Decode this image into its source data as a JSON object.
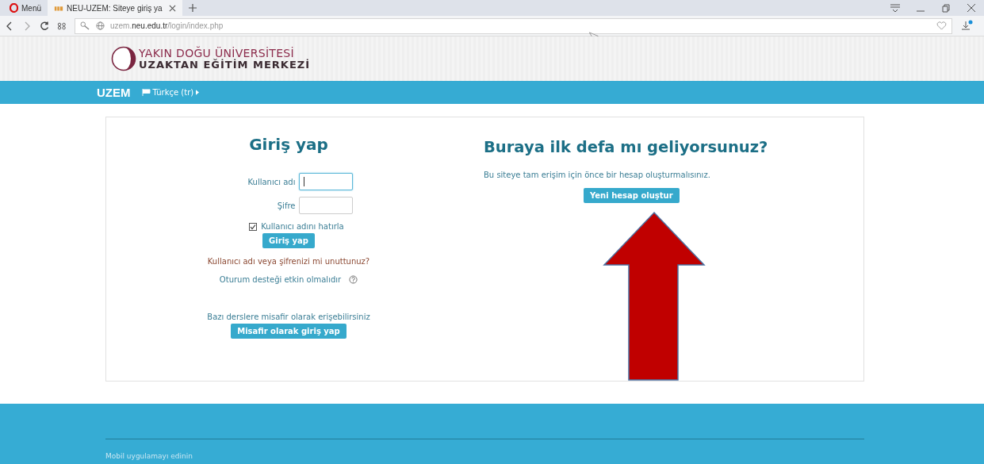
{
  "browser": {
    "tabs": [
      {
        "kind": "menu",
        "label": "Menü",
        "selected": false
      },
      {
        "kind": "page",
        "label": "NEU-UZEM: Siteye giriş ya",
        "selected": true
      }
    ],
    "address": {
      "subdomain": "uzem.",
      "domain": "neu.edu.tr",
      "path": "/login/index.php"
    }
  },
  "header": {
    "logo_lines": [
      "YAKIN DOĞU ÜNİVERSİTESİ",
      "UZAKTAN EĞİTİM MERKEZİ"
    ]
  },
  "navbar": {
    "brand": "UZEM",
    "language": "Türkçe (tr)"
  },
  "login": {
    "title": "Giriş yap",
    "fields": [
      {
        "label": "Kullanıcı adı",
        "focused": true
      },
      {
        "label": "Şifre",
        "focused": false
      }
    ],
    "remember": {
      "label": "Kullanıcı adını hatırla",
      "checked": true
    },
    "submit": "Giriş yap",
    "forgot": "Kullanıcı adı veya şifrenizi mi unuttunuz?",
    "session_note": "Oturum desteği etkin olmalıdır",
    "guest_note": "Bazı derslere misafir olarak erişebilirsiniz",
    "guest_button": "Misafir olarak giriş yap"
  },
  "signup": {
    "title": "Buraya ilk defa mı geliyorsunuz?",
    "text": "Bu siteye tam erişim için önce bir hesap oluşturmalısınız.",
    "button": "Yeni hesap oluştur"
  },
  "annotation": {
    "kind": "arrow"
  },
  "footer": {
    "link": "Mobil uygulamayı edinin"
  }
}
